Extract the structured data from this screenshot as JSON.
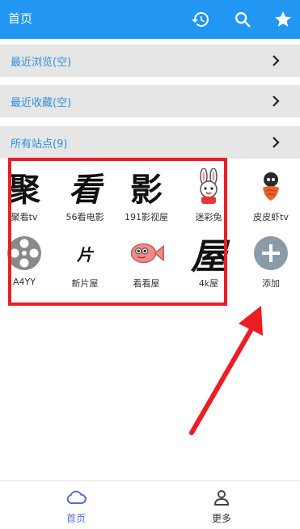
{
  "header": {
    "title": "首页",
    "icons": [
      "history-icon",
      "search-icon",
      "star-icon"
    ]
  },
  "sections": [
    {
      "label": "最近浏览(空)"
    },
    {
      "label": "最近收藏(空)"
    },
    {
      "label": "所有站点(9)"
    }
  ],
  "sites": [
    {
      "name": "聚看tv",
      "icon_text": "聚"
    },
    {
      "name": "56看电影",
      "icon_text": "看"
    },
    {
      "name": "191影视屋",
      "icon_text": "影"
    },
    {
      "name": "迷彩兔",
      "icon_text": ""
    },
    {
      "name": "皮皮虾tv",
      "icon_text": ""
    },
    {
      "name": "A4YY",
      "icon_text": ""
    },
    {
      "name": "新片屋",
      "icon_text": "片"
    },
    {
      "name": "看看屋",
      "icon_text": ""
    },
    {
      "name": "4k屋",
      "icon_text": "屋"
    },
    {
      "name": "添加",
      "icon_text": ""
    }
  ],
  "bottom_nav": [
    {
      "label": "首页",
      "active": true
    },
    {
      "label": "更多",
      "active": false
    }
  ],
  "colors": {
    "primary": "#2196f3",
    "accent_text": "#2b8fe0",
    "highlight_box": "#ee1c24",
    "nav_active": "#5a6fd6",
    "add_button": "#8a9ba8"
  }
}
